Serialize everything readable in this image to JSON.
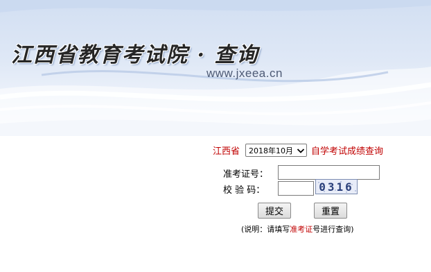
{
  "header": {
    "site_title": "江西省教育考试院 · 查询",
    "site_url": "www.jxeea.cn"
  },
  "form": {
    "province_label": "江西省",
    "exam_select": {
      "selected": "2018年10月"
    },
    "query_title": "自学考试成绩查询",
    "ticket_label": "准考证号：",
    "ticket_value": "",
    "captcha_label": "校 验 码：",
    "captcha_value": "",
    "captcha_image_text": "0316",
    "submit_label": "提交",
    "reset_label": "重置",
    "note": {
      "prefix": "(说明：请填写",
      "highlight_1": "准考证",
      "middle": "号",
      "suffix": "进行查询)"
    }
  },
  "colors": {
    "highlight_red": "#c00000",
    "banner_blue": "#d2dff2"
  }
}
